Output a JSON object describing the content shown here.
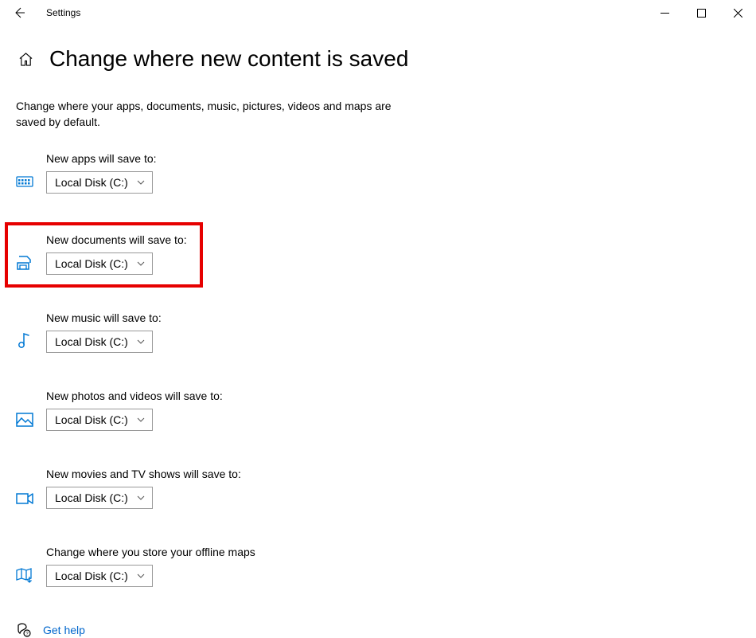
{
  "window": {
    "title": "Settings"
  },
  "page": {
    "heading": "Change where new content is saved",
    "description": "Change where your apps, documents, music, pictures, videos and maps are saved by default."
  },
  "settings": [
    {
      "label": "New apps will save to:",
      "value": "Local Disk (C:)",
      "icon": "apps"
    },
    {
      "label": "New documents will save to:",
      "value": "Local Disk (C:)",
      "icon": "documents"
    },
    {
      "label": "New music will save to:",
      "value": "Local Disk (C:)",
      "icon": "music"
    },
    {
      "label": "New photos and videos will save to:",
      "value": "Local Disk (C:)",
      "icon": "photos"
    },
    {
      "label": "New movies and TV shows will save to:",
      "value": "Local Disk (C:)",
      "icon": "movies"
    },
    {
      "label": "Change where you store your offline maps",
      "value": "Local Disk (C:)",
      "icon": "maps"
    }
  ],
  "help": {
    "label": "Get help"
  }
}
